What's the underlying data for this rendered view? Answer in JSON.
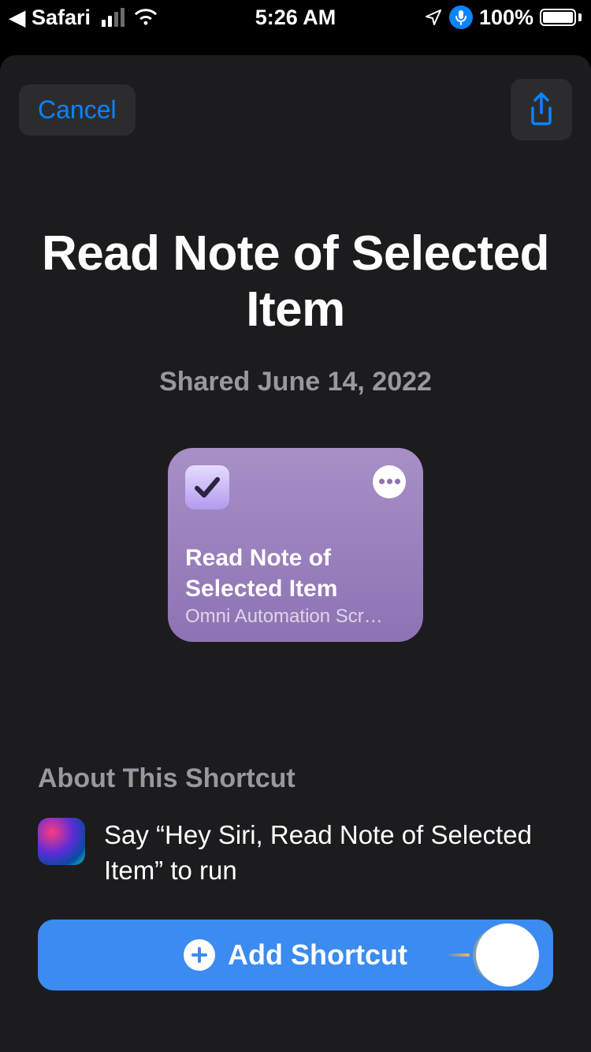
{
  "status": {
    "back_app": "Safari",
    "time": "5:26 AM",
    "battery_percent": "100%"
  },
  "header": {
    "cancel_label": "Cancel"
  },
  "shortcut": {
    "title": "Read Note of Selected Item",
    "shared_line": "Shared June 14, 2022",
    "tile_title": "Read Note of Selected Item",
    "tile_subtitle": "Omni Automation Scr…"
  },
  "about": {
    "heading": "About This Shortcut",
    "siri_hint": "Say “Hey Siri, Read Note of Selected Item” to run"
  },
  "cta": {
    "add_label": "Add Shortcut"
  }
}
